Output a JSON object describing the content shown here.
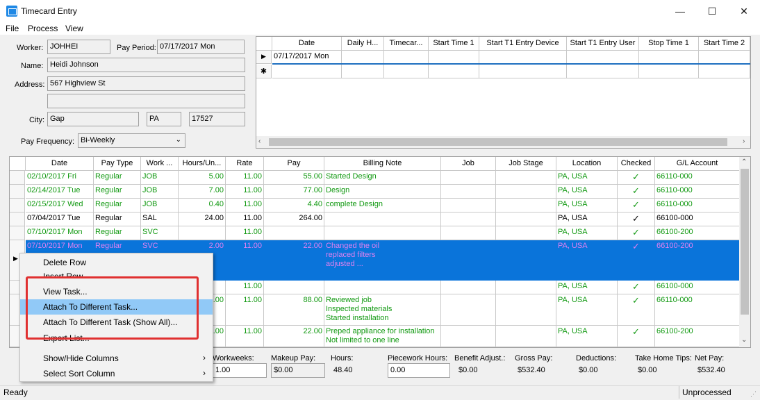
{
  "window": {
    "title": "Timecard Entry",
    "minimize": "—",
    "maximize": "☐",
    "close": "✕"
  },
  "menus": [
    "File",
    "Process",
    "View"
  ],
  "form": {
    "worker_label": "Worker:",
    "worker": "JOHHEI",
    "pay_period_label": "Pay Period:",
    "pay_period": "07/17/2017 Mon",
    "name_label": "Name:",
    "name": "Heidi Johnson",
    "address_label": "Address:",
    "address1": "567 Highview St",
    "address2": "",
    "city_label": "City:",
    "city": "Gap",
    "state": "PA",
    "zip": "17527",
    "pay_freq_label": "Pay Frequency:",
    "pay_freq": "Bi-Weekly"
  },
  "top_grid": {
    "headers": [
      "Date",
      "Daily H...",
      "Timecar...",
      "Start Time 1",
      "Start T1 Entry Device",
      "Start T1 Entry User",
      "Stop Time 1",
      "Start Time 2"
    ],
    "row_date": "07/17/2017 Mon",
    "row_marker": "▶",
    "new_marker": "✱"
  },
  "main_grid": {
    "headers": [
      "Date",
      "Pay Type",
      "Work ...",
      "Hours/Un...",
      "Rate",
      "Pay",
      "Billing Note",
      "Job",
      "Job Stage",
      "Location",
      "Checked",
      "G/L Account"
    ],
    "rows": [
      {
        "date": "02/10/2017 Fri",
        "paytype": "Regular",
        "work": "JOB",
        "hours": "5.00",
        "rate": "11.00",
        "pay": "55.00",
        "note": "Started Design",
        "location": "PA, USA",
        "checked": "✓",
        "gl": "66110-000"
      },
      {
        "date": "02/14/2017 Tue",
        "paytype": "Regular",
        "work": "JOB",
        "hours": "7.00",
        "rate": "11.00",
        "pay": "77.00",
        "note": "Design",
        "location": "PA, USA",
        "checked": "✓",
        "gl": "66110-000"
      },
      {
        "date": "02/15/2017 Wed",
        "paytype": "Regular",
        "work": "JOB",
        "hours": "0.40",
        "rate": "11.00",
        "pay": "4.40",
        "note": "complete Design",
        "location": "PA, USA",
        "checked": "✓",
        "gl": "66110-000"
      },
      {
        "date": "07/04/2017 Tue",
        "paytype": "Regular",
        "work": "SAL",
        "hours": "24.00",
        "rate": "11.00",
        "pay": "264.00",
        "note": "",
        "location": "PA, USA",
        "checked": "✓",
        "gl": "66100-000"
      },
      {
        "date": "07/10/2017 Mon",
        "paytype": "Regular",
        "work": "SVC",
        "hours": "",
        "rate": "11.00",
        "pay": "",
        "note": "",
        "location": "PA, USA",
        "checked": "✓",
        "gl": "66100-200"
      },
      {
        "date": "07/10/2017 Mon",
        "paytype": "Regular",
        "work": "SVC",
        "hours": "2.00",
        "rate": "11.00",
        "pay": "22.00",
        "note": "Changed the oil\nreplaced filters\nadjusted ...",
        "location": "PA, USA",
        "checked": "✓",
        "gl": "66100-200"
      },
      {
        "date": "",
        "paytype": "",
        "work": "",
        "hours": "",
        "rate": "11.00",
        "pay": "",
        "note": "",
        "location": "PA, USA",
        "checked": "✓",
        "gl": "66100-000"
      },
      {
        "date": "",
        "paytype": "",
        "work": "",
        "hours": ".00",
        "rate": "11.00",
        "pay": "88.00",
        "note": "Reviewed job\nInspected materials\nStarted installation",
        "location": "PA, USA",
        "checked": "✓",
        "gl": "66110-000"
      },
      {
        "date": "",
        "paytype": "",
        "work": "",
        "hours": ".00",
        "rate": "11.00",
        "pay": "22.00",
        "note": "Preped appliance for installation\nNot limited to one line",
        "location": "PA, USA",
        "checked": "✓",
        "gl": "66100-200"
      }
    ]
  },
  "context_menu": {
    "items": [
      "Delete Row",
      "Insert Row",
      "View Task...",
      "Attach To Different Task...",
      "Attach To Different Task (Show All)...",
      "Export List...",
      "Show/Hide Columns",
      "Select Sort Column"
    ],
    "arrow": "›"
  },
  "summary": {
    "workweeks_label": "Workweeks:",
    "workweeks": "1.00",
    "makeup_label": "Makeup Pay:",
    "makeup": "$0.00",
    "hours_label": "Hours:",
    "hours": "48.40",
    "piecework_label": "Piecework Hours:",
    "piecework": "0.00",
    "benefit_label": "Benefit Adjust.:",
    "benefit": "$0.00",
    "gross_label": "Gross Pay:",
    "gross": "$532.40",
    "deductions_label": "Deductions:",
    "deductions": "$0.00",
    "tips_label": "Take Home Tips:",
    "tips": "$0.00",
    "net_label": "Net Pay:",
    "net": "$532.40"
  },
  "status": {
    "left": "Ready",
    "right": "Unprocessed"
  }
}
